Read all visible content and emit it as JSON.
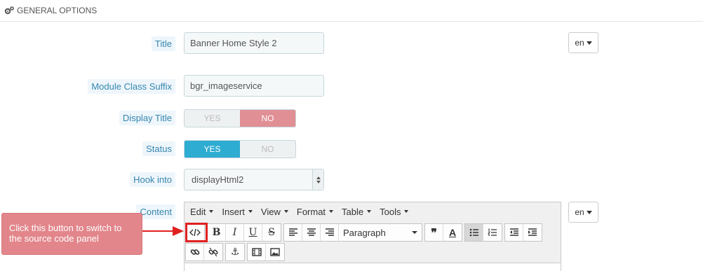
{
  "panel": {
    "title": "GENERAL OPTIONS",
    "icon": "cogs-icon"
  },
  "form": {
    "title_label": "Title",
    "title_value": "Banner Home Style 2",
    "title_lang": "en",
    "suffix_label": "Module Class Suffix",
    "suffix_value": "bgr_imageservice",
    "display_title_label": "Display Title",
    "display_title_yes": "YES",
    "display_title_no": "NO",
    "display_title_selected": "NO",
    "status_label": "Status",
    "status_yes": "YES",
    "status_no": "NO",
    "status_selected": "YES",
    "hook_label": "Hook into",
    "hook_value": "displayHtml2",
    "content_label": "Content",
    "content_lang": "en"
  },
  "editor": {
    "menus": [
      "Edit",
      "Insert",
      "View",
      "Format",
      "Table",
      "Tools"
    ],
    "format_select": "Paragraph"
  },
  "annotation": {
    "callout_text": "Click this button to switch to the source code panel",
    "color": "#e02020"
  },
  "colors": {
    "label": "#3586ae",
    "switch_no_active": "#e08f95",
    "switch_yes_active": "#2eacd1"
  }
}
